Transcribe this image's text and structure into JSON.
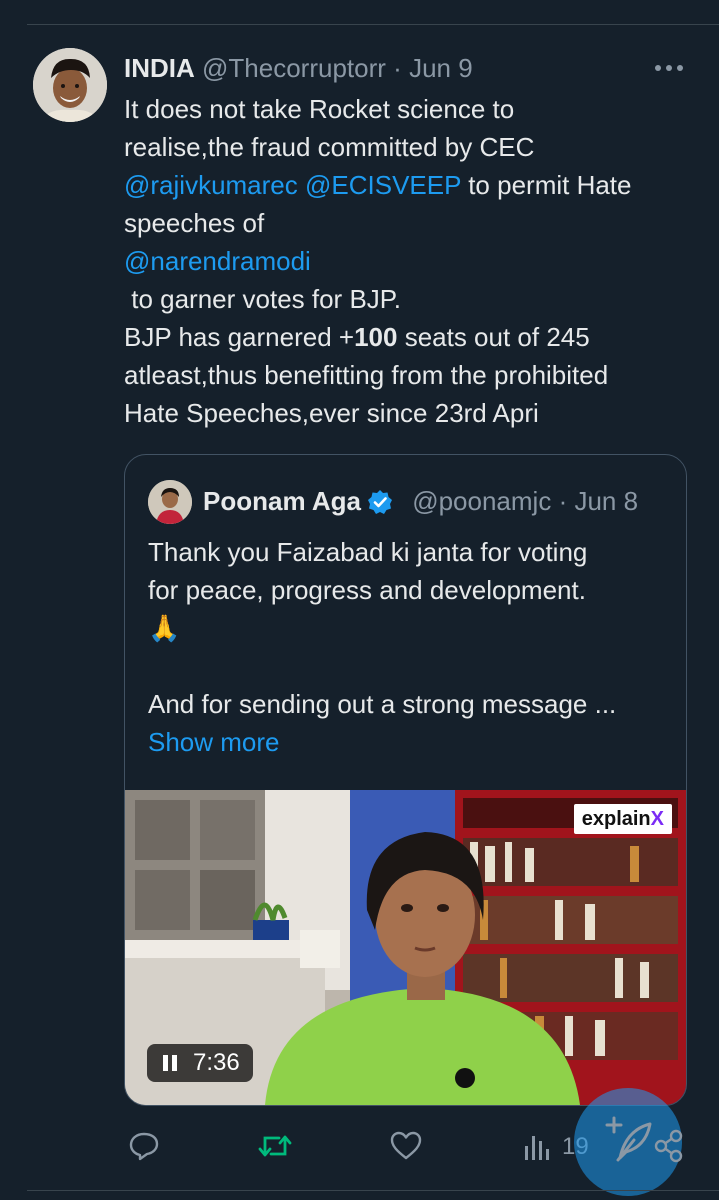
{
  "tweet": {
    "author_name": "INDIA",
    "handle": "@Thecorruptorr",
    "separator": "·",
    "date": "Jun 9",
    "text_lines": {
      "l1": "It does not take Rocket science to",
      "l2": "realise,the fraud committed by CEC",
      "l3_mention1": "@rajivkumarec",
      "l3_mention2": "@ECISVEEP",
      "l3_rest": " to permit Hate",
      "l4": "speeches of",
      "l5_mention": "@narendramodi",
      "l6": " to garner votes for BJP.",
      "l7_before": "BJP has garnered +",
      "l7_bold": "100",
      "l7_after": " seats out of 245",
      "l8": "atleast,thus benefitting from the prohibited",
      "l9": "Hate Speeches,ever since 23rd Apri"
    }
  },
  "quote": {
    "author_name": "Poonam Aga",
    "handle": "@poonamjc",
    "separator": "·",
    "date": "Jun 8",
    "text_lines": {
      "l1": "Thank you Faizabad ki janta for voting",
      "l2": "for peace, progress and development.",
      "l3": "🙏",
      "l4": "And for sending out a strong message ...",
      "show_more": "Show more"
    },
    "media": {
      "brand_prefix": "explain",
      "brand_suffix": "X",
      "duration": "7:36"
    }
  },
  "actions": {
    "views": "19"
  },
  "icons": {
    "more": "more-dots-icon",
    "verified": "verified-badge-icon",
    "reply": "reply-icon",
    "retweet": "retweet-icon",
    "like": "like-icon",
    "views": "views-icon",
    "share": "share-icon",
    "compose": "compose-feather-icon",
    "pause": "pause-icon"
  },
  "colors": {
    "background": "#15202b",
    "text": "#e7e9ea",
    "muted": "#8b98a5",
    "link": "#1d9bf0",
    "retweet_green": "#00ba7c",
    "border": "#425364"
  }
}
